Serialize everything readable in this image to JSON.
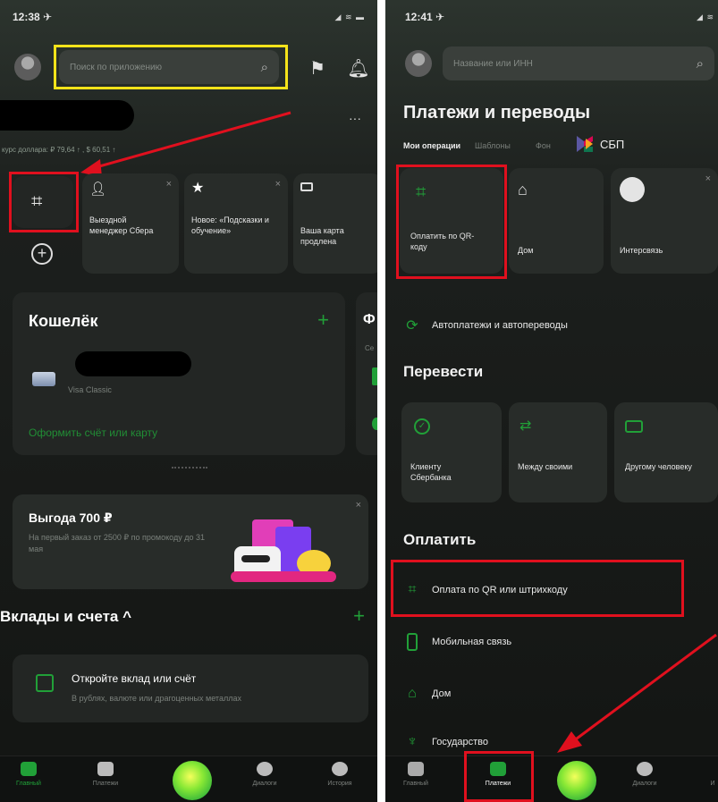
{
  "left": {
    "status": {
      "time": "12:38 ✈",
      "icons": "◢ ≋ ▬"
    },
    "search_placeholder": "Поиск по приложению",
    "rate_text": "курс доллара: ₽ 79,64 ↑ , $ 60,51 ↑",
    "menu_dots": "···",
    "quick_tiles": [
      {
        "label": "Выездной менеджер Сбера"
      },
      {
        "label": "Новое: «Подсказки и обучение»"
      },
      {
        "label": "Ваша карта продлена"
      }
    ],
    "close_symbol": "×",
    "plus_symbol": "+",
    "wallet": {
      "title": "Кошелёк",
      "card_type": "Visa Classic",
      "apply_link": "Оформить счёт или карту",
      "side_letter": "Ф",
      "side_small": "Се"
    },
    "promo": {
      "title": "Выгода 700 ₽",
      "desc": "На первый заказ от 2500 ₽ по промокоду до 31 мая"
    },
    "deposits": {
      "title": "Вклады и счета ^",
      "open_title": "Откройте вклад или счёт",
      "open_desc": "В рублях, валюте или драгоценных металлах"
    },
    "nav": [
      "Главный",
      "Платежи",
      "",
      "Диалоги",
      "История"
    ]
  },
  "right": {
    "status": {
      "time": "12:41 ✈",
      "icons": "◢ ≋"
    },
    "search_placeholder": "Название или ИНН",
    "title": "Платежи и переводы",
    "tabs": [
      "Мои операции",
      "Шаблоны",
      "Фон"
    ],
    "sbp": "СБП",
    "tiles": [
      {
        "label": "Оплатить по QR-коду"
      },
      {
        "label": "Дом"
      },
      {
        "label": "Интерсвязь"
      }
    ],
    "auto": "Автоплатежи и автопереводы",
    "transfer_title": "Перевести",
    "transfers": [
      {
        "label": "Клиенту Сбербанка"
      },
      {
        "label": "Между своими"
      },
      {
        "label": "Другому человеку"
      }
    ],
    "pay_title": "Оплатить",
    "pay_rows": [
      "Оплата по QR или штрихкоду",
      "Мобильная связь",
      "Дом",
      "Государство"
    ],
    "nav": [
      "Главный",
      "Платежи",
      "",
      "Диалоги",
      "И"
    ]
  },
  "colors": {
    "accent_green": "#21a038",
    "annotation_red": "#e0101e",
    "annotation_yellow": "#f5e31a"
  }
}
